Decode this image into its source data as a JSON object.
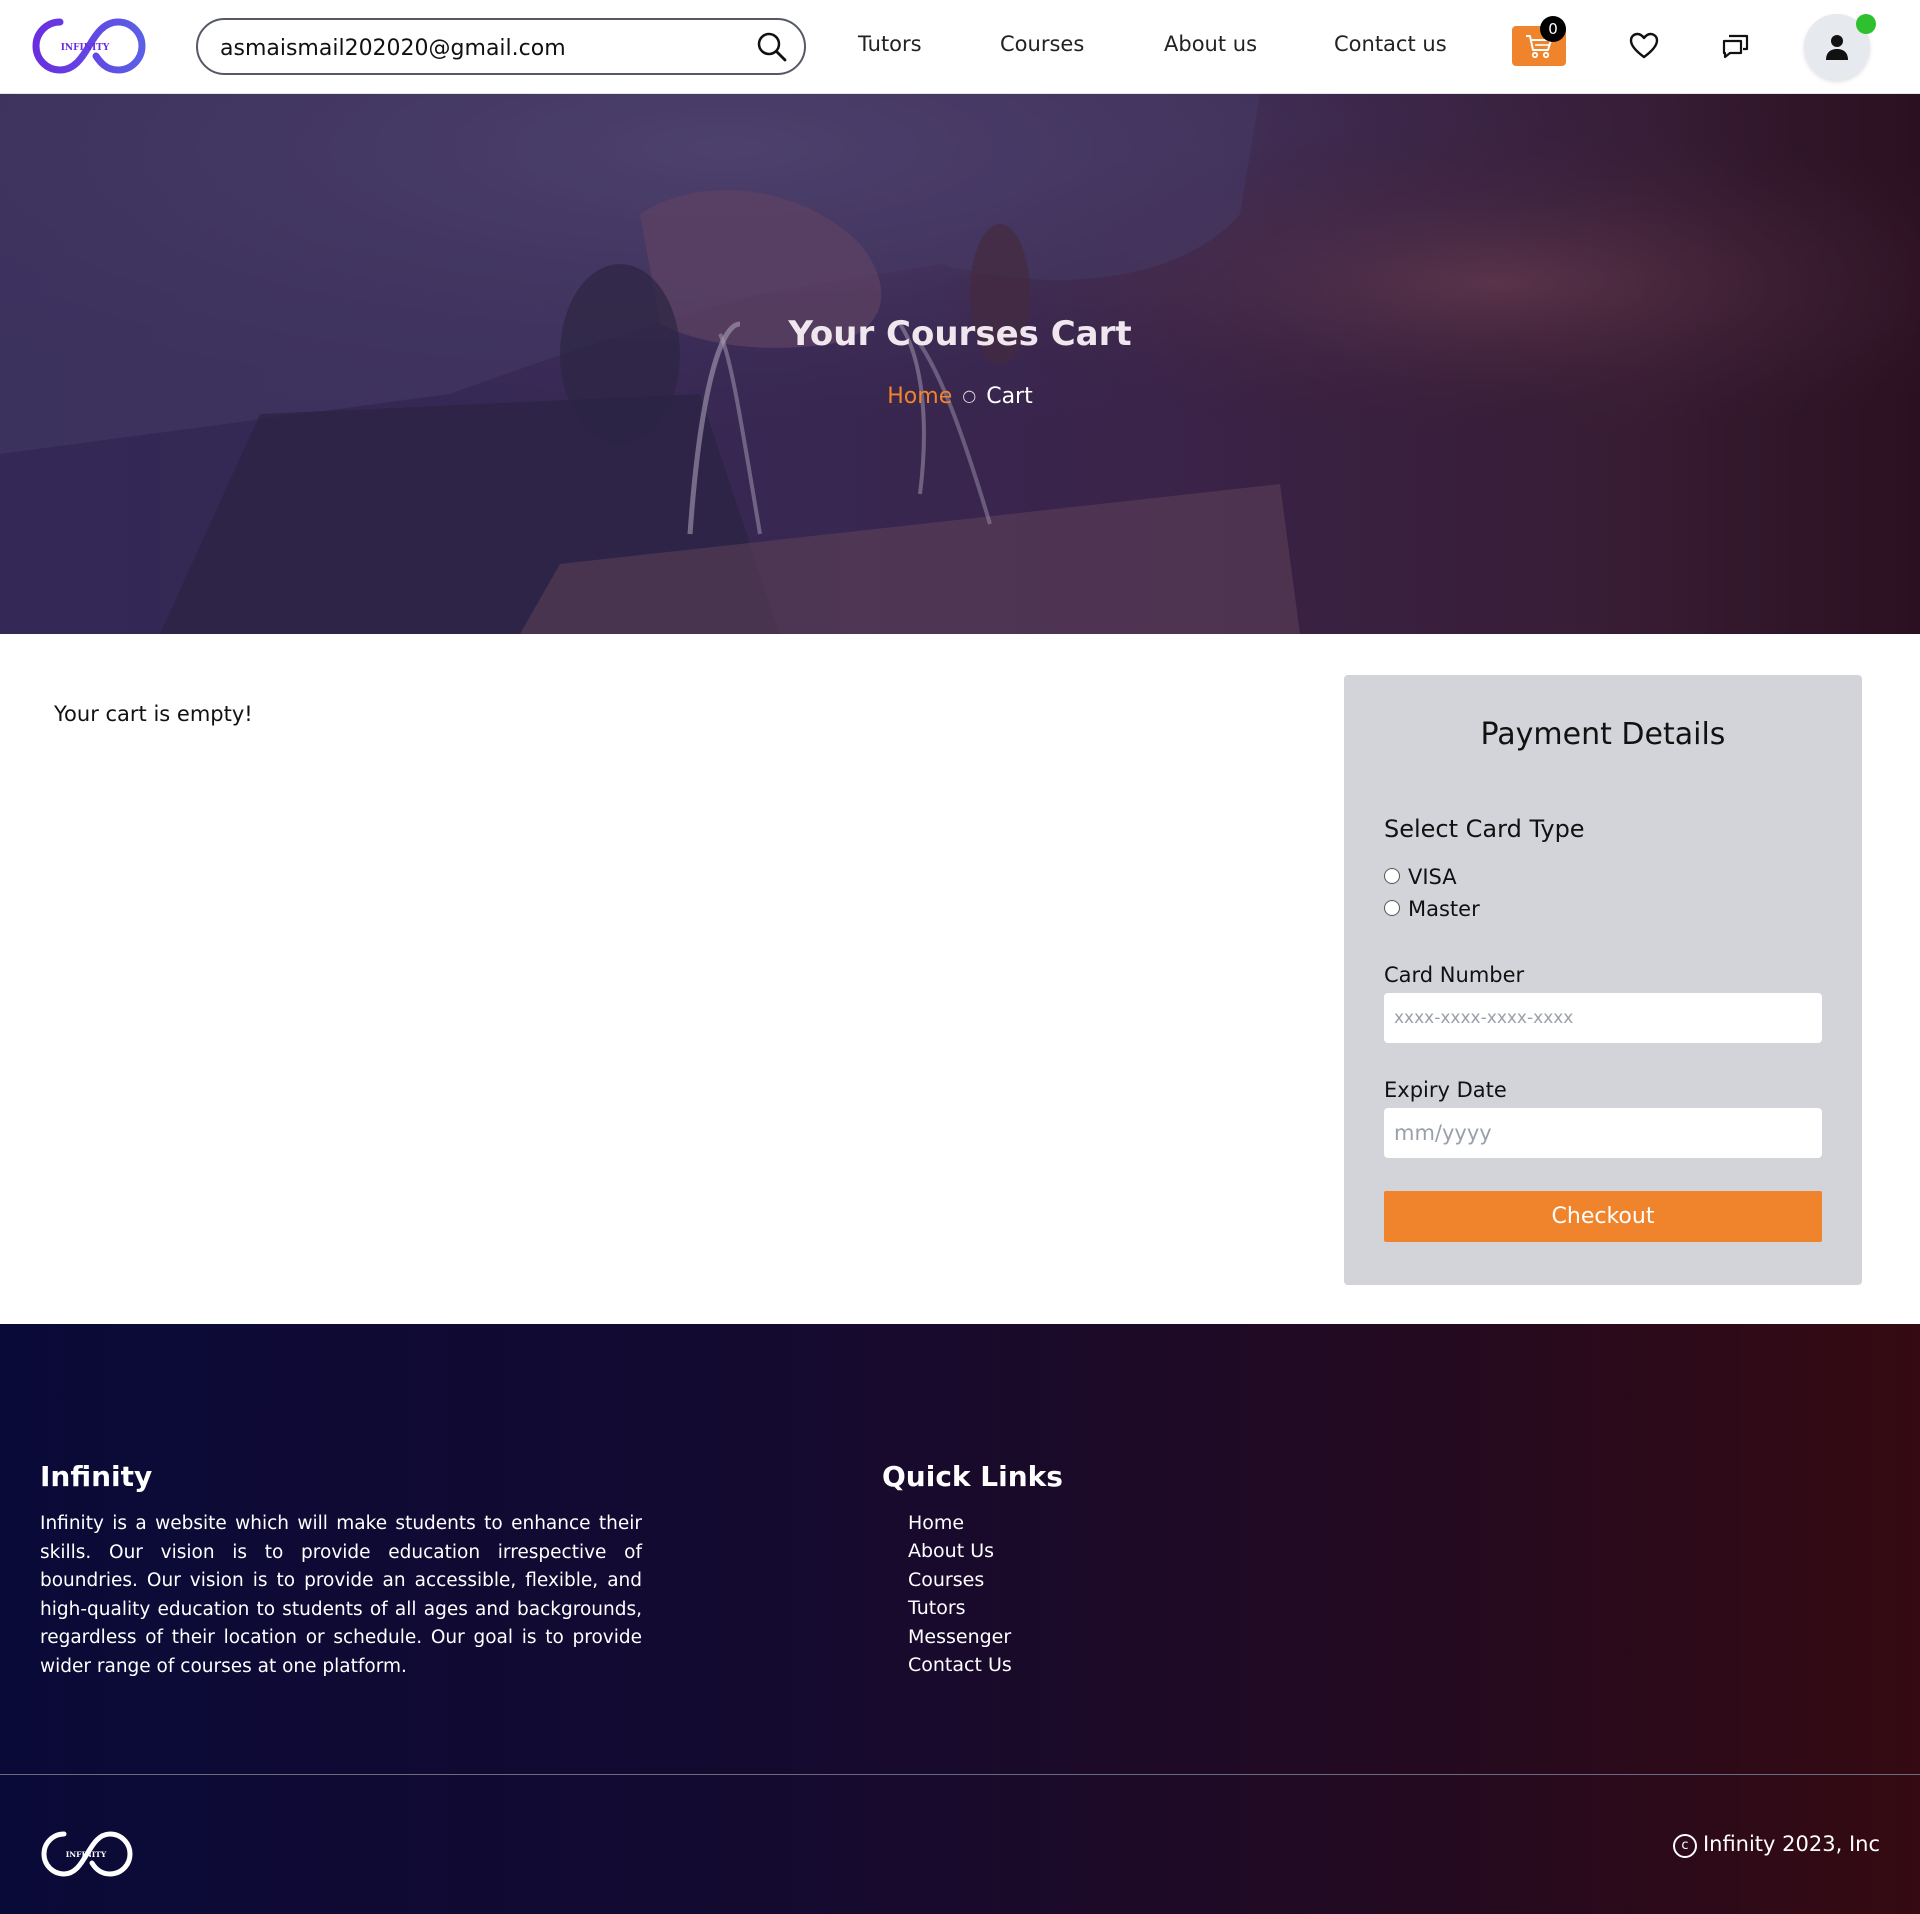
{
  "header": {
    "logo_text": "INFINITY",
    "search": {
      "value": "asmaismail202020@gmail.com",
      "placeholder": ""
    },
    "nav": [
      "Tutors",
      "Courses",
      "About us",
      "Contact us"
    ],
    "cart_count": "0",
    "icons": [
      "search-icon",
      "cart-icon",
      "heart-icon",
      "chat-icon",
      "user-icon"
    ],
    "accent_color": "#f0842c"
  },
  "hero": {
    "title": "Your Courses Cart",
    "breadcrumb": {
      "home": "Home",
      "separator": "○",
      "current": "Cart"
    }
  },
  "cart": {
    "empty_message": "Your cart is empty!"
  },
  "payment": {
    "title": "Payment Details",
    "card_type_label": "Select Card Type",
    "card_types": [
      "VISA",
      "Master"
    ],
    "card_number_label": "Card Number",
    "card_number_placeholder": "xxxx-xxxx-xxxx-xxxx",
    "expiry_label": "Expiry Date",
    "expiry_placeholder": "mm/yyyy",
    "checkout_label": "Checkout"
  },
  "footer": {
    "about_title": "Infinity",
    "about_text": "Infinity is a website which will make students to enhance their skills. Our vision is to provide education irrespective of boundries. Our vision is to provide an accessible, flexible, and high-quality education to students of all ages and backgrounds, regardless of their location or schedule. Our goal is to provide wider range of courses at one platform.",
    "links_title": "Quick Links",
    "links": [
      "Home",
      "About Us",
      "Courses",
      "Tutors",
      "Messenger",
      "Contact Us"
    ],
    "logo_text": "INFINITY",
    "copyright": "Infinity 2023, Inc"
  }
}
